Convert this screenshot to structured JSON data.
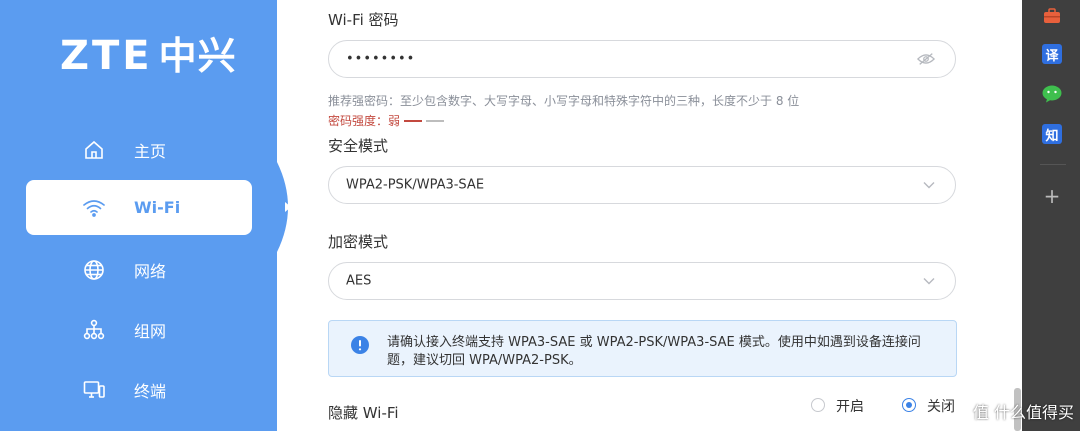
{
  "brand": {
    "logo_latin": "ZTE",
    "logo_cjk": "中兴"
  },
  "sidebar": {
    "items": [
      {
        "label": "主页",
        "icon": "home-icon",
        "active": false
      },
      {
        "label": "Wi-Fi",
        "icon": "wifi-icon",
        "active": true
      },
      {
        "label": "网络",
        "icon": "globe-icon",
        "active": false
      },
      {
        "label": "组网",
        "icon": "mesh-network-icon",
        "active": false
      },
      {
        "label": "终端",
        "icon": "device-icon",
        "active": false
      }
    ]
  },
  "form": {
    "password": {
      "label": "Wi-Fi 密码",
      "value": "••••••••",
      "hint": "推荐强密码：至少包含数字、大写字母、小写字母和特殊字符中的三种，长度不少于 8 位",
      "strength_label": "密码强度：弱"
    },
    "security_mode": {
      "label": "安全模式",
      "value": "WPA2-PSK/WPA3-SAE"
    },
    "encryption_mode": {
      "label": "加密模式",
      "value": "AES"
    },
    "notice": "请确认接入终端支持 WPA3-SAE 或 WPA2-PSK/WPA3-SAE 模式。使用中如遇到设备连接问题，建议切回 WPA/WPA2-PSK。",
    "hidden_wifi": {
      "label": "隐藏 Wi-Fi",
      "option_on": "开启",
      "option_off": "关闭",
      "selected": "off"
    }
  },
  "toolbar": {
    "items": [
      "briefcase-icon",
      "translate-icon",
      "wechat-icon",
      "zhihu-icon",
      "plus-icon"
    ],
    "translate_label": "译",
    "zhihu_label": "知",
    "plus_label": "+"
  },
  "watermark": "值 什么值得买",
  "colors": {
    "sidebar_bg": "#5b9cf0",
    "accent": "#3b82e6",
    "weak_strength": "#c3493f",
    "notice_bg": "#eaf3fd",
    "toolbar_bg": "#3f3f3f"
  }
}
